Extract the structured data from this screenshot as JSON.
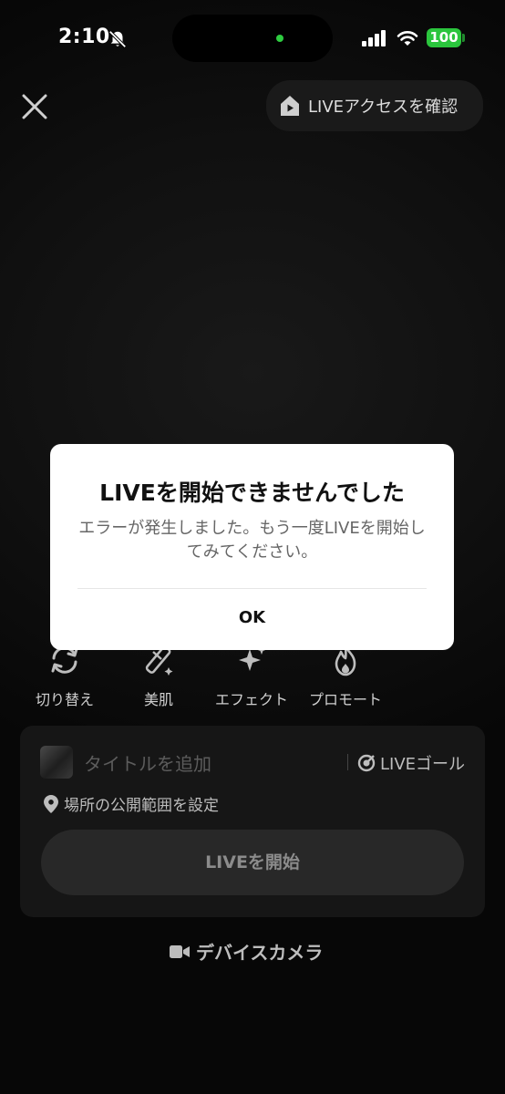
{
  "status_bar": {
    "time": "2:10",
    "battery": "100",
    "battery_color": "#2bc53d",
    "icons": [
      "bell-slash-icon",
      "cellular-signal-icon",
      "wifi-icon",
      "battery-icon"
    ]
  },
  "header": {
    "close_icon": "close-icon",
    "live_access_label": "LIVEアクセスを確認"
  },
  "dialog": {
    "title": "LIVEを開始できませんでした",
    "message": "エラーが発生しました。もう一度LIVEを開始してみてください。",
    "ok_label": "OK"
  },
  "tools": [
    {
      "label": "切り替え",
      "icon": "switch-camera-icon"
    },
    {
      "label": "美肌",
      "icon": "beauty-wand-icon"
    },
    {
      "label": "エフェクト",
      "icon": "sparkle-effects-icon"
    },
    {
      "label": "プロモート",
      "icon": "flame-promote-icon"
    }
  ],
  "panel": {
    "title_placeholder": "タイトルを追加",
    "goal_label": "LIVEゴール",
    "location_label": "場所の公開範囲を設定",
    "start_button": "LIVEを開始"
  },
  "device_camera": "デバイスカメラ"
}
